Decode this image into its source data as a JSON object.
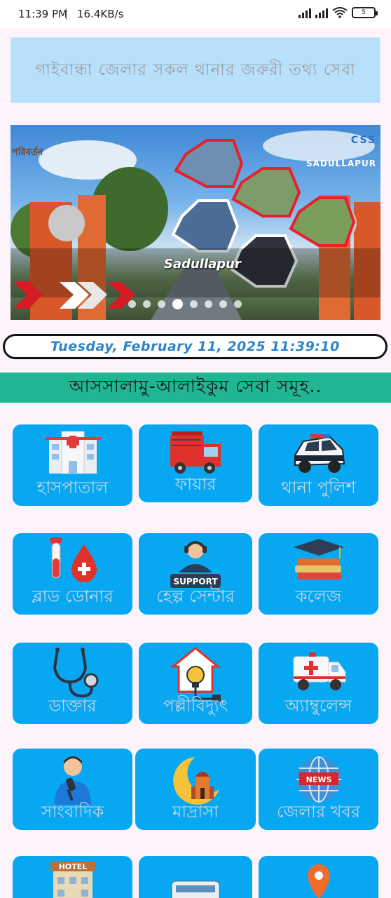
{
  "statusbar": {
    "time": "11:39 PM",
    "separator": "|",
    "speed": "16.4KB/s",
    "battery": "5"
  },
  "banner": {
    "title": "গাইবান্ধা জেলার সকল থানার জরুরী তথ্য সেবা"
  },
  "slider": {
    "caption": "Sadullapur",
    "brand_left": "পরিবর্তন",
    "brand_right": "SADULLAPUR",
    "brand_right_logo": "CSS",
    "dot_count": 8,
    "active_dot": 4
  },
  "datetime": {
    "text": "Tuesday,  February  11,  2025 11:39:10"
  },
  "greeting": {
    "text": "আসসালামু-আলাইকুম সেবা সমূহ.."
  },
  "services": [
    {
      "label": "হাসপাতাল",
      "icon": "hospital-icon"
    },
    {
      "label": "ফায়ার",
      "icon": "fire-truck-icon"
    },
    {
      "label": "থানা পুলিশ",
      "icon": "police-car-icon"
    },
    {
      "label": "ব্লাড ডোনার",
      "icon": "blood-donor-icon"
    },
    {
      "label": "হেল্প সেন্টার",
      "icon": "support-icon",
      "icon_text": "SUPPORT"
    },
    {
      "label": "কলেজ",
      "icon": "college-icon"
    },
    {
      "label": "ডাক্তার",
      "icon": "stethoscope-icon"
    },
    {
      "label": "পল্লীবিদ্যুৎ",
      "icon": "electricity-icon"
    },
    {
      "label": "অ্যাম্বুলেন্স",
      "icon": "ambulance-icon"
    },
    {
      "label": "সাংবাদিক",
      "icon": "journalist-icon"
    },
    {
      "label": "মাদ্রাসা",
      "icon": "madrasa-icon"
    },
    {
      "label": "জেলার খবর",
      "icon": "news-icon",
      "icon_text": "NEWS"
    },
    {
      "label": "",
      "icon": "hotel-icon",
      "icon_text": "HOTEL"
    },
    {
      "label": "",
      "icon": "bus-icon"
    },
    {
      "label": "",
      "icon": "location-icon"
    }
  ],
  "colors": {
    "tile": "#07a7f2",
    "greeting_bar": "#20b593",
    "banner": "#b8e0fb",
    "date_text": "#2e86c8"
  }
}
